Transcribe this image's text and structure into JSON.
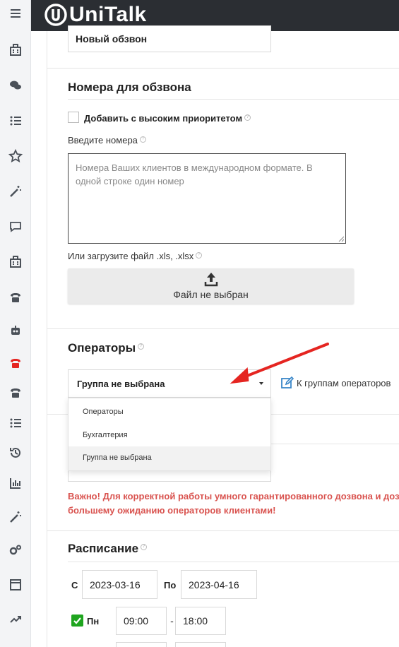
{
  "app": {
    "logo_text": "UniTalk"
  },
  "sidebar": {
    "items": [
      {
        "icon": "hamburger-menu-icon"
      },
      {
        "icon": "building-icon"
      },
      {
        "icon": "chat-bubbles-icon"
      },
      {
        "icon": "list-icon"
      },
      {
        "icon": "star-icon"
      },
      {
        "icon": "magic-wand-icon"
      },
      {
        "icon": "comment-icon"
      },
      {
        "icon": "building-icon"
      },
      {
        "icon": "phone-icon"
      },
      {
        "icon": "robot-icon"
      },
      {
        "icon": "phone-red-icon"
      },
      {
        "icon": "phone-icon"
      },
      {
        "icon": "list-icon"
      },
      {
        "icon": "history-icon"
      },
      {
        "icon": "bar-chart-icon"
      },
      {
        "icon": "magic-wand-icon"
      },
      {
        "icon": "gears-icon"
      },
      {
        "icon": "window-icon"
      },
      {
        "icon": "trend-up-icon"
      }
    ]
  },
  "campaign": {
    "name_value": "Новый обзвон"
  },
  "numbers": {
    "title": "Номера для обзвона",
    "priority_label": "Добавить с высоким приоритетом",
    "enter_label": "Введите номера",
    "textarea_placeholder": "Номера Ваших клиентов в международном формате. В одной строке один номер",
    "upload_label": "Или загрузите файл .xls, .xlsx",
    "file_status": "Файл не выбран"
  },
  "operators": {
    "title": "Операторы",
    "selected": "Группа не выбрана",
    "groups_link": "К группам операторов",
    "options": [
      "Операторы",
      "Бухгалтерия",
      "Группа не выбрана"
    ]
  },
  "warning": {
    "line1": "Важно! Для корректной работы умного гарантированного дозвона и дозво",
    "line2": "большему ожиданию операторов клиентами!"
  },
  "schedule": {
    "title": "Расписание",
    "from_label": "С",
    "from_date": "2023-03-16",
    "to_label": "По",
    "to_date": "2023-04-16",
    "day_label": "Пн",
    "start_time": "09:00",
    "dash": "-",
    "end_time": "18:00"
  },
  "colors": {
    "accent_red": "#e52521",
    "warning_red": "#d9534f",
    "check_green": "#1fa51f",
    "link_blue": "#3a87c8"
  }
}
